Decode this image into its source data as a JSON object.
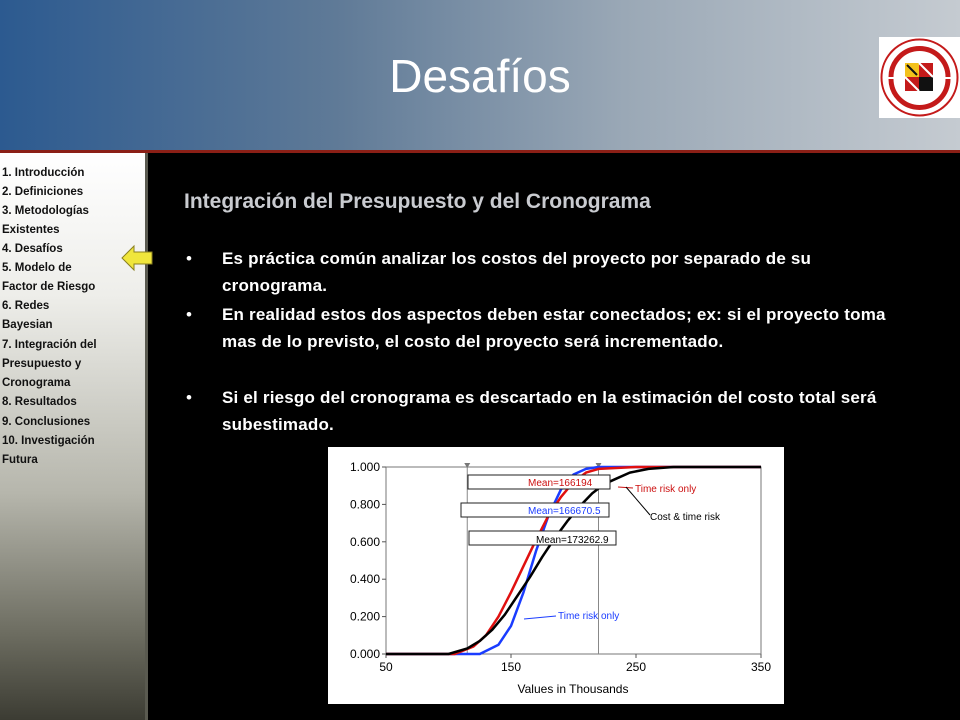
{
  "header": {
    "title": "Desafíos",
    "logo_icon": "university-of-maryland-seal"
  },
  "sidebar": {
    "items": [
      "1. Introducción",
      "2. Definiciones",
      "3. Metodologías",
      "    Existentes",
      "4. Desafíos",
      "5. Modelo de",
      "    Factor de Riesgo",
      "6.  Redes",
      "     Bayesian",
      "7.  Integración del",
      "     Presupuesto y",
      "     Cronograma",
      "8.  Resultados",
      "9.  Conclusiones",
      "10. Investigación",
      "     Futura"
    ],
    "current_arrow_color": "#f0e63c"
  },
  "content": {
    "title": "Integración del Presupuesto y del Cronograma",
    "bullets": [
      "Es práctica común analizar los costos del proyecto por separado de su cronograma.",
      "En realidad estos dos aspectos deben estar conectados; ex: si el proyecto toma mas de lo previsto, el costo del proyecto será incrementado.",
      "Si el riesgo del cronograma es descartado en la estimación del costo total será subestimado."
    ],
    "bullet_symbol": "•"
  },
  "chart_data": {
    "type": "line",
    "xlabel": "Values in Thousands",
    "ylabel": "",
    "xlim": [
      50,
      350
    ],
    "ylim": [
      0,
      1
    ],
    "x_ticks": [
      "50",
      "150",
      "250",
      "350"
    ],
    "y_ticks": [
      "0.000",
      "0.200",
      "0.400",
      "0.600",
      "0.800",
      "1.000"
    ],
    "series": [
      {
        "color": "#1a3cff",
        "x": [
          50,
          125,
          140,
          150,
          160,
          170,
          180,
          190,
          200,
          210,
          220,
          250,
          350
        ],
        "y": [
          0,
          0,
          0.05,
          0.15,
          0.33,
          0.55,
          0.74,
          0.88,
          0.96,
          0.99,
          1,
          1,
          1
        ]
      },
      {
        "color": "#e01010",
        "x": [
          50,
          105,
          120,
          130,
          140,
          150,
          160,
          170,
          180,
          190,
          200,
          210,
          220,
          250,
          350
        ],
        "y": [
          0,
          0,
          0.04,
          0.1,
          0.2,
          0.33,
          0.47,
          0.61,
          0.74,
          0.84,
          0.92,
          0.97,
          0.99,
          1,
          1
        ]
      },
      {
        "color": "#000000",
        "x": [
          50,
          100,
          115,
          125,
          135,
          145,
          155,
          165,
          175,
          185,
          195,
          205,
          215,
          225,
          235,
          245,
          260,
          280,
          350
        ],
        "y": [
          0,
          0,
          0.03,
          0.07,
          0.13,
          0.21,
          0.31,
          0.41,
          0.52,
          0.62,
          0.71,
          0.79,
          0.86,
          0.91,
          0.94,
          0.97,
          0.99,
          1,
          1
        ]
      }
    ],
    "markers": [
      {
        "text": "Mean=166194",
        "color": "#cc1010"
      },
      {
        "text": "Mean=166670.5",
        "color": "#1a3cff"
      },
      {
        "text": "Mean=173262.9",
        "color": "#000000"
      }
    ],
    "annotations": [
      {
        "text": "Time risk only",
        "color": "#cc1010"
      },
      {
        "text": "Cost & time risk",
        "color": "#000000"
      },
      {
        "text": "Time risk only",
        "color": "#1a3cff"
      }
    ],
    "vertical_lines_x": [
      115,
      220
    ]
  }
}
